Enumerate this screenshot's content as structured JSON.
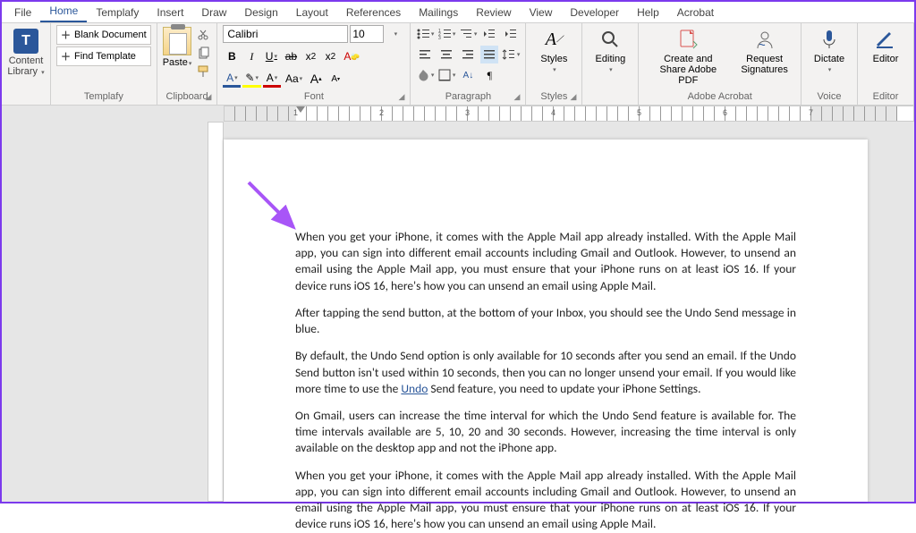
{
  "tabs": [
    "File",
    "Home",
    "Templafy",
    "Insert",
    "Draw",
    "Design",
    "Layout",
    "References",
    "Mailings",
    "Review",
    "View",
    "Developer",
    "Help",
    "Acrobat"
  ],
  "active_tab": "Home",
  "contentlib": {
    "label": "Content Library",
    "letter": "T",
    "dd": "▾"
  },
  "templafy": {
    "blank": "Blank Document",
    "find": "Find Template",
    "group": "Templafy"
  },
  "clipboard": {
    "paste": "Paste",
    "group": "Clipboard"
  },
  "font": {
    "name": "Calibri",
    "size": "10",
    "bold": "B",
    "italic": "I",
    "underline": "U",
    "strike": "ab",
    "sub": "x",
    "sup": "x",
    "cleartext": "A",
    "color_a": "A",
    "highlight_a": "A",
    "case": "Aa",
    "grow": "A",
    "shrink": "A",
    "group": "Font"
  },
  "paragraph": {
    "group": "Paragraph"
  },
  "styles": {
    "label": "Styles",
    "group": "Styles"
  },
  "editing": {
    "label": "Editing"
  },
  "acrobat": {
    "create": "Create and Share Adobe PDF",
    "sig": "Request Signatures",
    "group": "Adobe Acrobat"
  },
  "voice": {
    "dictate": "Dictate",
    "group": "Voice"
  },
  "editor": {
    "label": "Editor",
    "group": "Editor"
  },
  "ruler_nums": [
    "",
    "1",
    "2",
    "3",
    "4",
    "5",
    "6",
    "7"
  ],
  "doc": {
    "p1": "When you get your iPhone, it comes with the Apple Mail app already installed. With the Apple Mail app, you can sign into different email accounts including Gmail and Outlook. However, to unsend an email using the Apple Mail app, you must ensure that your iPhone runs on at least iOS 16. If your device runs iOS 16, here's how you can unsend an email using Apple Mail.",
    "p2": "After tapping the send button, at the bottom of your Inbox, you should see the Undo Send message in blue.",
    "p3a": "By default, the Undo Send option is only available for 10 seconds after you send an email. If the Undo Send button isn't used within 10 seconds, then you can no longer unsend your email. If you would like more time to use the ",
    "p3link": "Undo",
    "p3b": " Send feature, you need to update your iPhone Settings.",
    "p4": "On Gmail, users can increase the time interval for which the Undo Send feature is available for. The time intervals available are 5, 10, 20 and 30 seconds. However, increasing the time interval is only available on the desktop app and not the iPhone app.",
    "p5": "When you get your iPhone, it comes with the Apple Mail app already installed. With the Apple Mail app, you can sign into different email accounts including Gmail and Outlook. However, to unsend an email using the Apple Mail app, you must ensure that your iPhone runs on at least iOS 16. If your device runs iOS 16, here's how you can unsend an email using Apple Mail."
  }
}
